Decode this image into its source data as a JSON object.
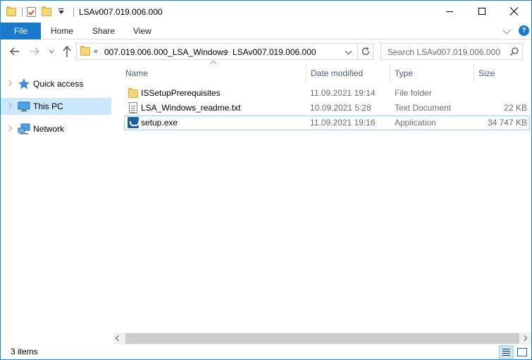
{
  "window": {
    "title": "LSAv007.019.006.000"
  },
  "ribbon": {
    "tabs": [
      {
        "label": "File"
      },
      {
        "label": "Home"
      },
      {
        "label": "Share"
      },
      {
        "label": "View"
      }
    ]
  },
  "address": {
    "overflow": "«",
    "crumbs": [
      "007.019.006.000_LSA_Windows",
      "LSAv007.019.006.000"
    ]
  },
  "search": {
    "placeholder": "Search LSAv007.019.006.000"
  },
  "sidebar": {
    "items": [
      {
        "label": "Quick access",
        "icon": "star-icon"
      },
      {
        "label": "This PC",
        "icon": "computer-icon",
        "selected": true
      },
      {
        "label": "Network",
        "icon": "network-icon"
      }
    ]
  },
  "filelist": {
    "columns": [
      "Name",
      "Date modified",
      "Type",
      "Size"
    ],
    "rows": [
      {
        "name": "ISSetupPrerequisites",
        "date": "11.09.2021 19:14",
        "type": "File folder",
        "size": "",
        "icon": "folder-icon"
      },
      {
        "name": "LSA_Windows_readme.txt",
        "date": "10.09.2021 5:28",
        "type": "Text Document",
        "size": "22 KB",
        "icon": "text-document-icon"
      },
      {
        "name": "setup.exe",
        "date": "11.09.2021 19:16",
        "type": "Application",
        "size": "34 747 KB",
        "icon": "setup-application-icon"
      }
    ]
  },
  "status": {
    "item_count": "3 items"
  },
  "colors": {
    "accent": "#1979ca",
    "selection": "#cce8ff",
    "header_text": "#4c607a"
  }
}
